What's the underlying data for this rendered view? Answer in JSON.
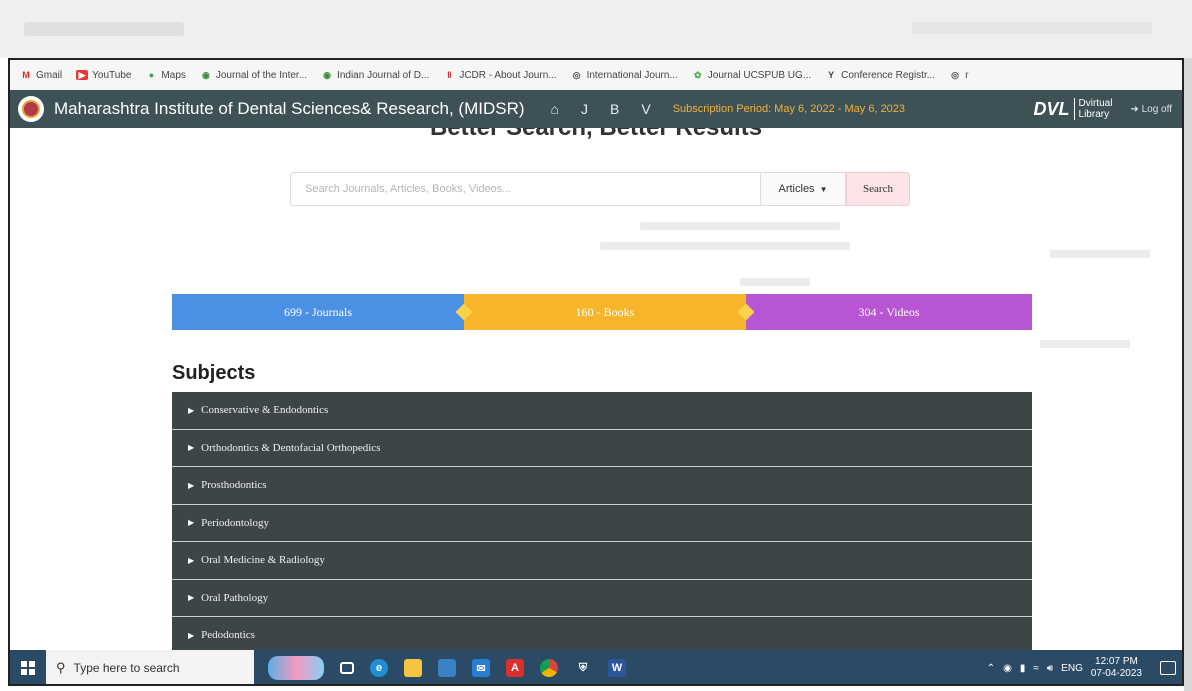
{
  "bookmarks": [
    {
      "label": "Gmail",
      "icon": "gmail-icon",
      "color": "#d93025"
    },
    {
      "label": "YouTube",
      "icon": "youtube-icon",
      "color": "#e53935"
    },
    {
      "label": "Maps",
      "icon": "maps-icon",
      "color": "#34a853"
    },
    {
      "label": "Journal of the Inter...",
      "icon": "globe-icon",
      "color": "#3b8d3b"
    },
    {
      "label": "Indian Journal of D...",
      "icon": "globe-icon",
      "color": "#3b8d3b"
    },
    {
      "label": "JCDR - About Journ...",
      "icon": "jcdr-icon",
      "color": "#c62828"
    },
    {
      "label": "International Journ...",
      "icon": "globe-icon",
      "color": "#555555"
    },
    {
      "label": "Journal UCSPUB UG...",
      "icon": "ucspub-icon",
      "color": "#4caf50"
    },
    {
      "label": "Conference Registr...",
      "icon": "conference-icon",
      "color": "#444444"
    },
    {
      "label": "r",
      "icon": "globe-icon",
      "color": "#555555"
    }
  ],
  "header": {
    "title": "Maharashtra Institute of Dental Sciences& Research, (MIDSR)",
    "nav": [
      "J",
      "B",
      "V"
    ],
    "subscription": "Subscription Period: May 6, 2022 - May 6, 2023",
    "brand": "DVL",
    "brand_sub_1": "Dvirtual",
    "brand_sub_2": "Library",
    "logoff": "Log off"
  },
  "hero": {
    "heading": "Better Search, Better Results"
  },
  "search": {
    "placeholder": "Search Journals, Articles, Books, Videos...",
    "type": "Articles",
    "button": "Search"
  },
  "stats": {
    "journals": "699 - Journals",
    "books": "160 - Books",
    "videos": "304 - Videos"
  },
  "subjects": {
    "title": "Subjects",
    "items": [
      "Conservative & Endodontics",
      "Orthodontics & Dentofacial Orthopedics",
      "Prosthodontics",
      "Periodontology",
      "Oral Medicine & Radiology",
      "Oral Pathology",
      "Pedodontics"
    ]
  },
  "taskbar": {
    "search_placeholder": "Type here to search",
    "language": "ENG",
    "time": "12:07 PM",
    "date": "07-04-2023"
  },
  "colors": {
    "header_bg": "#3d5157",
    "journals": "#4a91e6",
    "books": "#f7b52c",
    "videos": "#b855d3",
    "subject_bg": "#3e4547",
    "subscription_text": "#f2b23a",
    "taskbar_bg": "#2a4a66"
  }
}
